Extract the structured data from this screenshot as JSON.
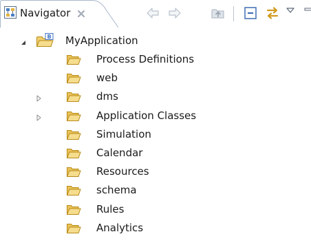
{
  "navigator": {
    "tab_title": "Navigator",
    "icons": {
      "view": "navigator-view-icon",
      "close": "close-icon",
      "back": "arrow-left-icon",
      "forward": "arrow-right-icon",
      "up": "up-folder-icon",
      "collapse": "collapse-all-icon",
      "link": "link-with-editor-icon",
      "menu": "view-menu-icon",
      "minimize": "minimize-icon"
    },
    "colors": {
      "folder": "#e2b441",
      "project": "#3f73c8",
      "text": "#1a1a1a",
      "tab_border": "#a9b8cc"
    }
  },
  "tree": {
    "project": {
      "label": "MyApplication",
      "expanded": true
    },
    "items": [
      {
        "label": "Process Definitions",
        "expandable": false
      },
      {
        "label": "web",
        "expandable": false
      },
      {
        "label": "dms",
        "expandable": true
      },
      {
        "label": "Application Classes",
        "expandable": true
      },
      {
        "label": "Simulation",
        "expandable": false
      },
      {
        "label": "Calendar",
        "expandable": false
      },
      {
        "label": "Resources",
        "expandable": false
      },
      {
        "label": "schema",
        "expandable": false
      },
      {
        "label": "Rules",
        "expandable": false
      },
      {
        "label": "Analytics",
        "expandable": false
      }
    ]
  }
}
